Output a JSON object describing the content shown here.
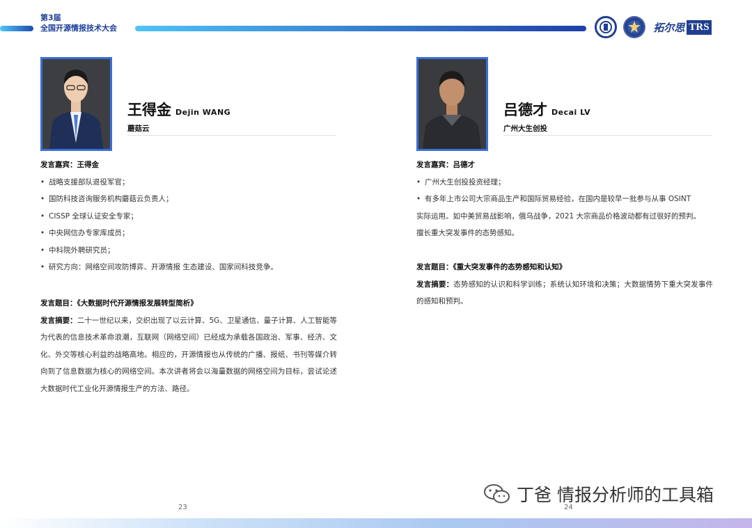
{
  "header": {
    "event_line1": "第3届",
    "event_line2": "全国开源情报技术大会",
    "logos": [
      "university-seal-icon",
      "police-emblem-icon",
      "trs-logo"
    ],
    "logo3_text": "拓尔思",
    "logo3_brand": "TRS"
  },
  "left_speaker": {
    "name_cn": "王得金",
    "name_en": "Dejin WANG",
    "org": "蘑菇云",
    "guest_label": "发言嘉宾：",
    "guest_name": "王得金",
    "bullets": [
      "战略支援部队退役军官；",
      "国防科技咨询服务机构蘑菇云负责人；",
      "CISSP 全球认证安全专家；",
      "中央网信办专家库成员；",
      "中科院外聘研究员；",
      "研究方向：网络空间攻防博弈、开源情报 生态建设、国家间科技竞争。"
    ],
    "topic_label": "发言题目：",
    "topic": "《大数据时代开源情报发展转型简析》",
    "abstract_label": "发言摘要：",
    "abstract": "二十一世纪以来，交织出现了以云计算、5G、卫星通信、量子计算、人工智能等为代表的信息技术革命浪潮，互联网（网络空间）已经成为承载各国政治、军事、经济、文化、外交等核心利益的战略高地。相应的，开源情报也从传统的广播、报纸、书刊等媒介转向到了信息数据为核心的网络空间。本次讲者将会以海量数据的网络空间为目标，尝试论述大数据时代工业化开源情报生产的方法、路径。",
    "page_number": "23"
  },
  "right_speaker": {
    "name_cn": "吕德才",
    "name_en": "Decai LV",
    "org": "广州大生创投",
    "guest_label": "发言嘉宾：",
    "guest_name": "吕德才",
    "bullets": [
      "广州大生创投投资经理；",
      "有多年上市公司大宗商品生产和国际贸易经验，在国内是较早一批参与从事 OSINT"
    ],
    "bullet_continuation": [
      "实际运用。如中美贸易战影响，俄乌战争，2021 大宗商品价格波动都有过很好的预判。",
      "擅长重大突发事件的态势感知。"
    ],
    "topic_label": "发言题目：",
    "topic": "《重大突发事件的态势感知和认知》",
    "abstract_label": "发言摘要：",
    "abstract": "态势感知的认识和科学训练；系统认知环境和决策；大数据情势下重大突发事件的感知和预判。",
    "page_number": "24"
  },
  "watermark": {
    "text": "丁爸 情报分析师的工具箱",
    "icon": "wechat-icon"
  },
  "colors": {
    "accent_blue": "#1f3f8f",
    "photo_border": "#3b6fd8",
    "header_gradient_start": "#4fc3f7"
  }
}
